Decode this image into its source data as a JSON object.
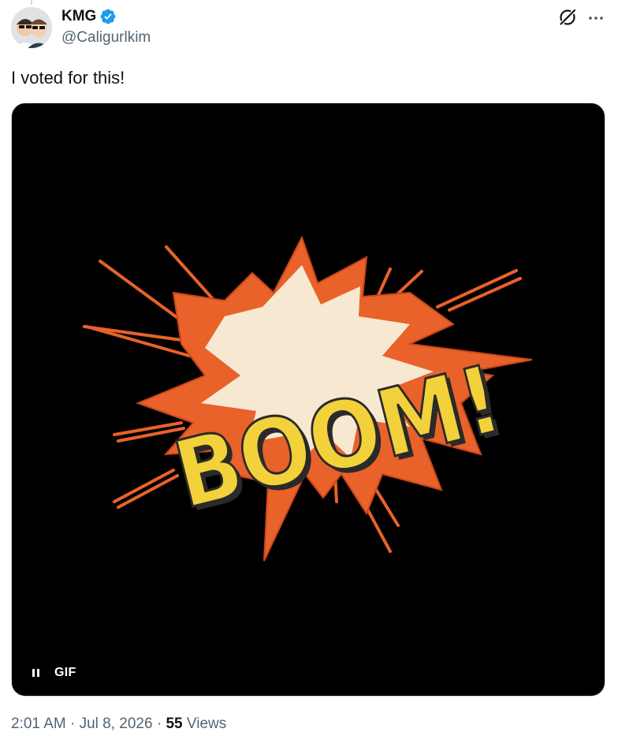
{
  "author": {
    "display_name": "KMG",
    "handle": "@Caligurlkim",
    "verified": true
  },
  "tweet": {
    "text": "I voted for this!"
  },
  "media": {
    "type": "GIF",
    "badge_label": "GIF",
    "content_text": "BOOM!",
    "playing": true
  },
  "meta": {
    "time": "2:01 AM",
    "separator": " · ",
    "date": "Jul 8, 2026",
    "views_count": "55",
    "views_label": "Views"
  },
  "icons": {
    "verified": "verified-badge-icon",
    "grok": "grok-icon",
    "more": "more-options-icon",
    "pause": "pause-icon"
  },
  "colors": {
    "verified_blue": "#1d9bf0",
    "text_primary": "#0f1419",
    "text_secondary": "#536471",
    "explosion_orange": "#e8622a",
    "boom_yellow": "#f3d13a"
  }
}
